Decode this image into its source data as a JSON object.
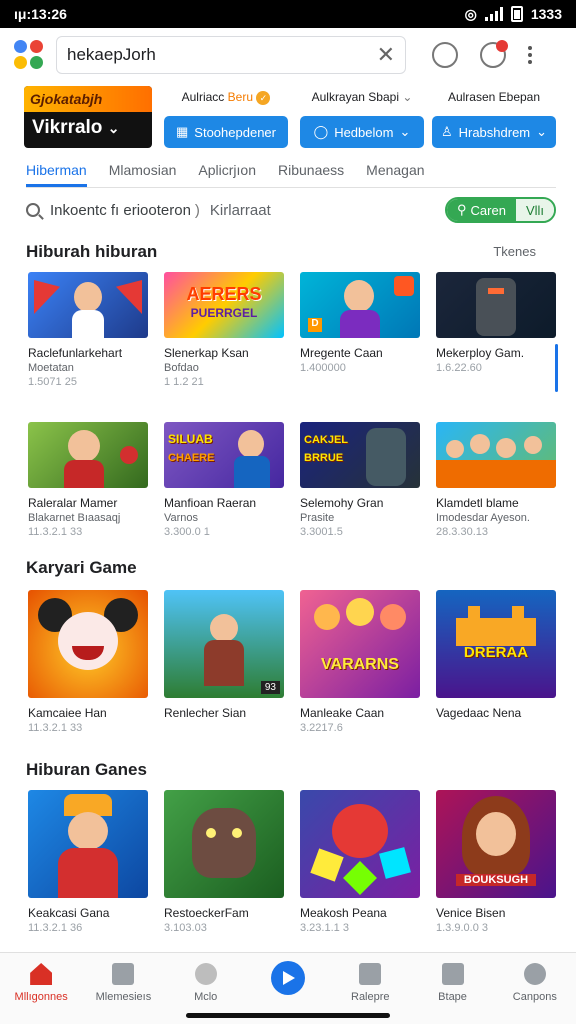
{
  "status": {
    "time": "ıμ:13:26",
    "right_text": "1333"
  },
  "search": {
    "value": "hekaepJorh",
    "placeholder": ""
  },
  "colors": {
    "accent": "#1a73e8",
    "green": "#34a853",
    "nav_active": "#d93025",
    "promo": "#ffb300"
  },
  "promo": {
    "top_text": "Gjokatabjh",
    "bottom_text": "Vikrralo"
  },
  "filters": [
    {
      "label": "Aulriacc",
      "badge": "Beru",
      "button": "Stoohepdener"
    },
    {
      "label": "Aulkrayan Sbapi",
      "button": "Hedbelom"
    },
    {
      "label": "Aulrasen Ebepan",
      "button": "Hrabshdrem"
    }
  ],
  "tabs": [
    "Hiberman",
    "Mlamosian",
    "Aplicrjıon",
    "Ribunaess",
    "Menagan"
  ],
  "filter_search": {
    "text": "Inkoentc fı eriooteron",
    "text2": "Kirlarraat",
    "btn_left": "Caren",
    "btn_right": "Vllı"
  },
  "sections": {
    "s1": {
      "title": "Hiburah hiburan",
      "more": "Tkenes"
    },
    "s2": {
      "title": "Karyari Game"
    },
    "s3": {
      "title": "Hiburan Ganes"
    }
  },
  "row1": [
    {
      "title": "Raclefunlarkehart",
      "sub": "Moetatan",
      "meta": "1.5071 25",
      "icon": "girl-flags"
    },
    {
      "title": "Slenerkap Ksan",
      "sub": "Bofdao",
      "meta": "1 1.2 21",
      "icon": "title-art"
    },
    {
      "title": "Mregente Caan",
      "sub": "",
      "meta": "1.400000",
      "icon": "boy-blue"
    },
    {
      "title": "Mekerploy Gam.",
      "sub": "",
      "meta": "1.6.22.60",
      "icon": "robot-dark"
    }
  ],
  "row1_art": {
    "c2": "AERERS",
    "c2b": "PUERRGEL"
  },
  "row2": [
    {
      "title": "Raleralar Mamer",
      "sub": "Blakarnet Bıaasaqj",
      "meta": "11.3.2.1 33",
      "icon": "boy-red"
    },
    {
      "title": "Manfioan Raeran",
      "sub": "Varnos",
      "meta": "3.300.0 1",
      "icon": "man-sign"
    },
    {
      "title": "Selemohy Gran",
      "sub": "Prasite",
      "meta": "3.3001.5",
      "icon": "soldier"
    },
    {
      "title": "Klamdetl blame",
      "sub": "Imodesdar Ayeson.",
      "meta": "28.3.30.13",
      "icon": "crowd"
    }
  ],
  "row2_art": {
    "c2": "SILUAB",
    "c2b": "CHAERE",
    "c3": "CAKJEL",
    "c3b": "BRRUE"
  },
  "row3": [
    {
      "title": "Kamcaiee Han",
      "sub": "",
      "meta": "11.3.2.1 33",
      "icon": "mouse"
    },
    {
      "title": "Renlecher Sian",
      "sub": "",
      "meta": "",
      "icon": "runner"
    },
    {
      "title": "Manleake Caan",
      "sub": "",
      "meta": "3.2217.6",
      "icon": "characters"
    },
    {
      "title": "Vagedaac Nena",
      "sub": "",
      "meta": "",
      "icon": "castle"
    }
  ],
  "row3_art": {
    "c3": "VARARNS",
    "c4": "DRERAA",
    "c2badge": "93"
  },
  "row4": [
    {
      "title": "Keakcasi Gana",
      "sub": "",
      "meta": "11.3.2.1 36",
      "icon": "hero-boy"
    },
    {
      "title": "RestoeckerFam",
      "sub": "",
      "meta": "3.103.03",
      "icon": "monster"
    },
    {
      "title": "Meakosh Peana",
      "sub": "",
      "meta": "3.23.1.1 3",
      "icon": "red-blob"
    },
    {
      "title": "Venice Bisen",
      "sub": "",
      "meta": "1.3.9.0.0 3",
      "icon": "woman"
    }
  ],
  "row4_art": {
    "c4": "BOUKSUGH"
  },
  "nav": [
    {
      "label": "Mllıgonnes",
      "icon": "home-icon",
      "active": true
    },
    {
      "label": "Mlemesieıs",
      "icon": "store-icon"
    },
    {
      "label": "Mclo",
      "icon": "games-icon"
    },
    {
      "label": "",
      "icon": "play-icon"
    },
    {
      "label": "Ralepre",
      "icon": "books-icon"
    },
    {
      "label": "Btape",
      "icon": "list-icon"
    },
    {
      "label": "Canpons",
      "icon": "account-icon"
    }
  ]
}
